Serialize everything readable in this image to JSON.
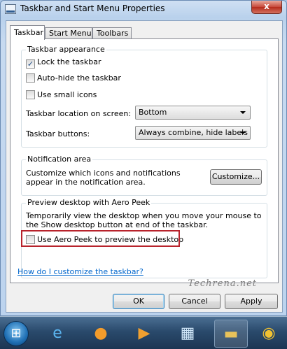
{
  "window": {
    "title": "Taskbar and Start Menu Properties",
    "close_glyph": "x"
  },
  "tabs": [
    {
      "label": "Taskbar"
    },
    {
      "label": "Start Menu"
    },
    {
      "label": "Toolbars"
    }
  ],
  "taskbar_appearance": {
    "title": "Taskbar appearance",
    "lock": {
      "label": "Lock the taskbar",
      "checked": true,
      "mark": "✓"
    },
    "autohide": {
      "label": "Auto-hide the taskbar",
      "checked": false
    },
    "small_icons": {
      "label": "Use small icons",
      "checked": false
    },
    "location_label": "Taskbar location on screen:",
    "location_value": "Bottom",
    "buttons_label": "Taskbar buttons:",
    "buttons_value": "Always combine, hide labels"
  },
  "notification_area": {
    "title": "Notification area",
    "description": "Customize which icons and notifications appear in the notification area.",
    "customize_label": "Customize..."
  },
  "aero_peek": {
    "title": "Preview desktop with Aero Peek",
    "description": "Temporarily view the desktop when you move your mouse to the Show desktop button at end of the taskbar.",
    "use_label": "Use Aero Peek to preview the desktop",
    "checked": false
  },
  "help_link": "How do I customize the taskbar?",
  "watermark": "Techrena.net",
  "buttons": {
    "ok": "OK",
    "cancel": "Cancel",
    "apply": "Apply"
  },
  "taskbar_icons": [
    "start-orb",
    "internet-explorer-icon",
    "firefox-icon",
    "media-player-icon",
    "live-icon",
    "explorer-folder-icon",
    "chrome-icon"
  ]
}
